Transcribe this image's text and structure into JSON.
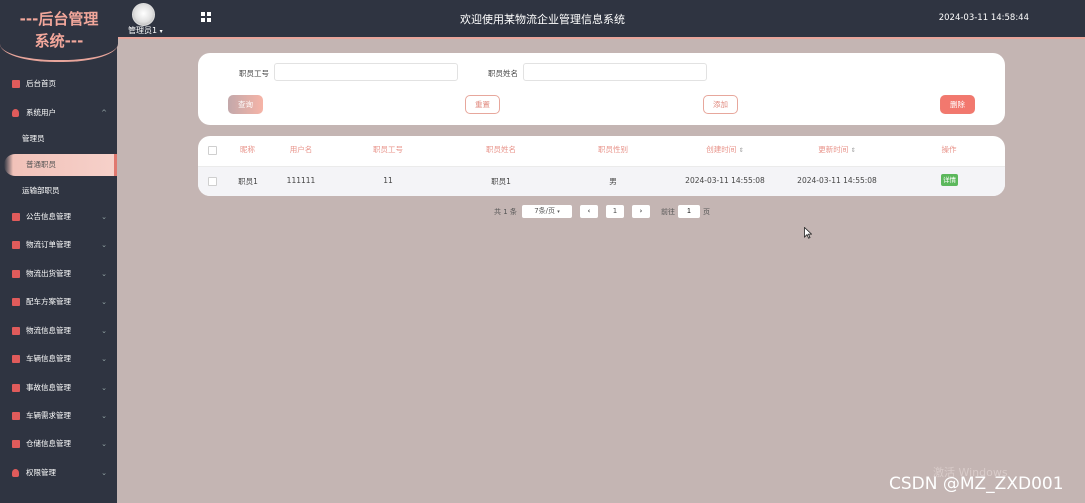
{
  "header": {
    "logo_line1": "---后台管理",
    "logo_line2": "系统---",
    "user_label": "管理员1",
    "user_caret": "▾",
    "app_title": "欢迎使用某物流企业管理信息系统",
    "datetime": "2024-03-11 14:58:44"
  },
  "sidebar": {
    "items": [
      {
        "label": "后台首页",
        "icon": "monitor-icon"
      },
      {
        "label": "系统用户",
        "icon": "person-icon",
        "expanded": true
      },
      {
        "label": "公告信息管理",
        "icon": "check-square-icon"
      },
      {
        "label": "物流订单管理",
        "icon": "check-square-icon"
      },
      {
        "label": "物流出货管理",
        "icon": "check-square-icon"
      },
      {
        "label": "配车方案管理",
        "icon": "check-square-icon"
      },
      {
        "label": "物流信息管理",
        "icon": "check-square-icon"
      },
      {
        "label": "车辆信息管理",
        "icon": "check-square-icon"
      },
      {
        "label": "事故信息管理",
        "icon": "check-square-icon"
      },
      {
        "label": "车辆需求管理",
        "icon": "check-square-icon"
      },
      {
        "label": "仓储信息管理",
        "icon": "check-square-icon"
      },
      {
        "label": "权限管理",
        "icon": "person-icon"
      }
    ],
    "sub_items": [
      {
        "label": "管理员"
      },
      {
        "label": "普通职员",
        "active": true
      },
      {
        "label": "运输部职员"
      }
    ]
  },
  "search": {
    "employee_no_label": "职员工号",
    "employee_no_value": "",
    "employee_name_label": "职员姓名",
    "employee_name_value": "",
    "query_label": "查询",
    "reset_label": "重置",
    "add_label": "添加",
    "delete_label": "删除"
  },
  "table": {
    "columns": [
      "昵称",
      "用户名",
      "职员工号",
      "职员姓名",
      "职员性别",
      "创建时间",
      "更新时间",
      "操作"
    ],
    "sort_glyph": "⇕",
    "rows": [
      {
        "nickname": "职员1",
        "username": "111111",
        "employee_no": "11",
        "employee_name": "职员1",
        "gender": "男",
        "created": "2024-03-11 14:55:08",
        "updated": "2024-03-11 14:55:08",
        "action": "详情"
      }
    ]
  },
  "pagination": {
    "total": "共 1 条",
    "page_size": "7条/页",
    "page_size_caret": "▾",
    "prev": "‹",
    "current_page": "1",
    "next": "›",
    "goto_label": "前往",
    "goto_value": "1",
    "page_suffix": "页"
  },
  "watermarks": {
    "windows": "激活 Windows",
    "csdn": "CSDN @MZ_ZXD001"
  },
  "colors": {
    "sidebar_bg": "#2f3441",
    "content_bg": "#c4b5b3",
    "accent": "#f2786e",
    "header_accent": "#e8938a",
    "detail_green": "#5cb85c"
  }
}
